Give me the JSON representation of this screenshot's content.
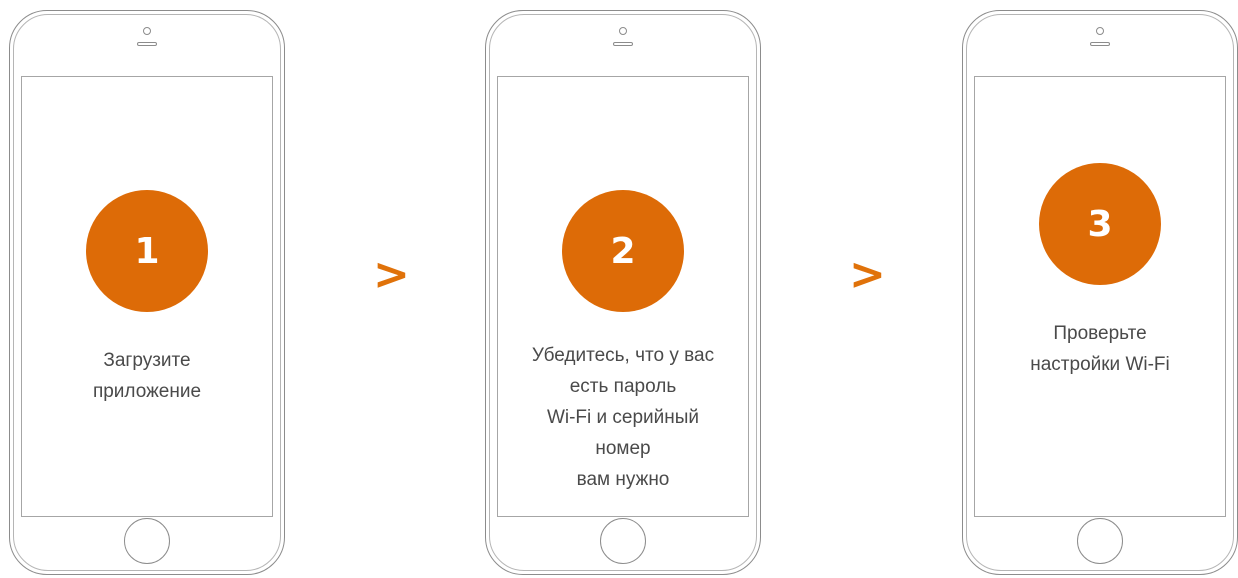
{
  "accent_color": "#dd6b07",
  "steps": [
    {
      "number": "1",
      "text": "Загрузите\nприложение"
    },
    {
      "number": "2",
      "text": "Убедитесь, что у вас\nесть пароль\nWi-Fi и серийный\nномер\nвам нужно"
    },
    {
      "number": "3",
      "text": "Проверьте\nнастройки Wi-Fi"
    }
  ],
  "arrows": [
    ">",
    ">"
  ]
}
